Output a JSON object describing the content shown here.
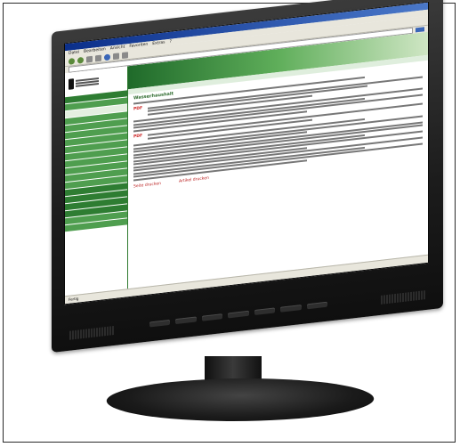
{
  "browser": {
    "title": "",
    "menu": [
      "Datei",
      "Bearbeiten",
      "Ansicht",
      "Favoriten",
      "Extras",
      "?"
    ],
    "address": "",
    "status": "Fertig"
  },
  "sidebar": {
    "items": [
      "",
      "",
      "",
      "",
      "",
      "",
      "",
      "",
      "",
      "",
      "",
      "",
      "",
      "",
      "",
      "",
      "",
      "",
      ""
    ]
  },
  "content": {
    "breadcrumb": "",
    "section_title": "Wasserhaushalt",
    "pdf_label": "PDF",
    "footer_left": "Seite drucken",
    "footer_right": "Artikel drucken"
  },
  "colors": {
    "accent": "#2e7d32",
    "bezel": "#1c1c1c"
  }
}
